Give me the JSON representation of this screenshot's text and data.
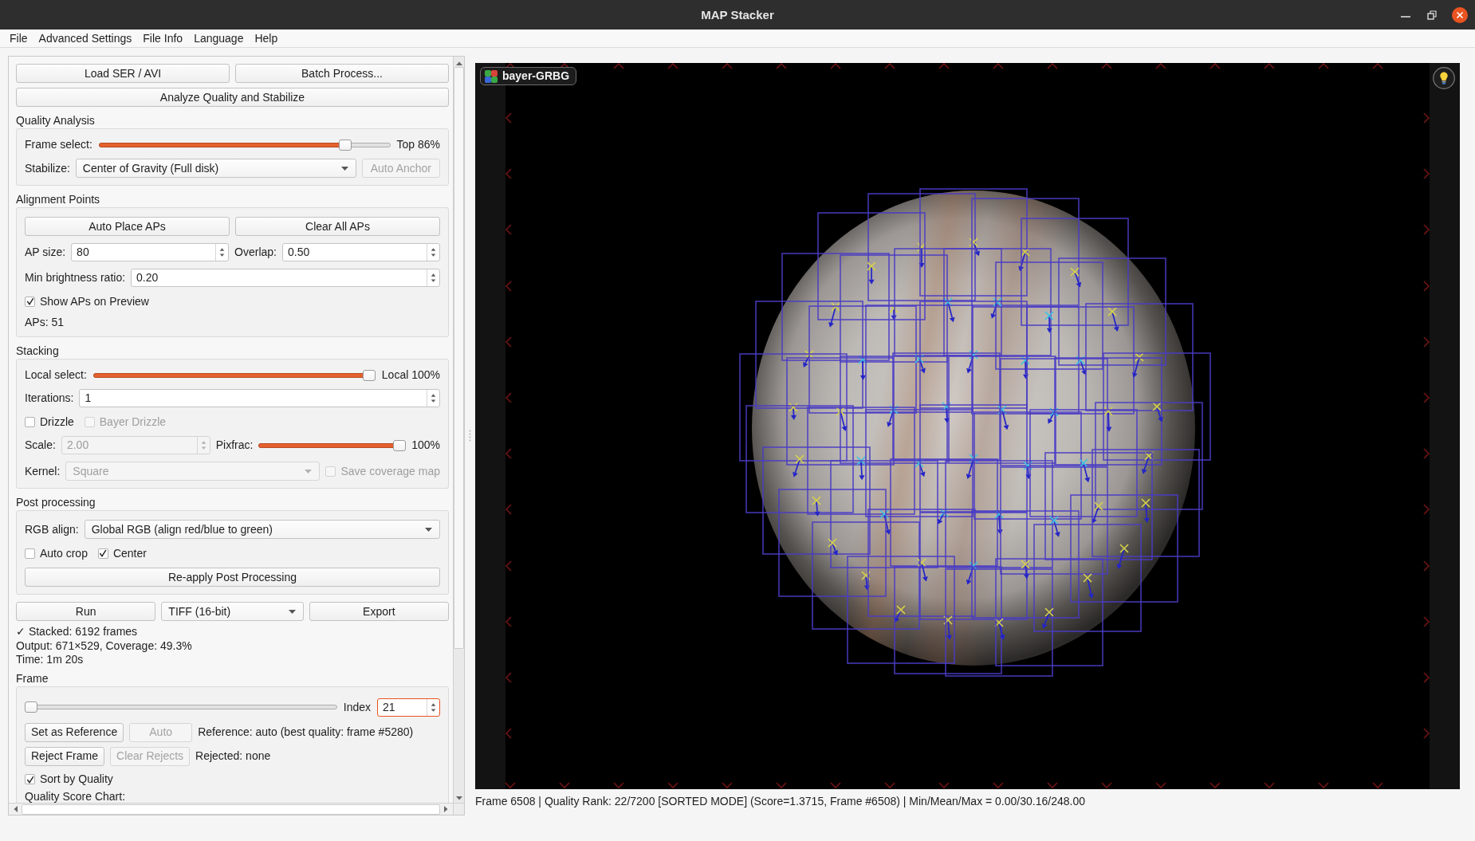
{
  "window": {
    "title": "MAP Stacker"
  },
  "menu": [
    {
      "label": "File"
    },
    {
      "label": "Advanced Settings"
    },
    {
      "label": "File Info"
    },
    {
      "label": "Language"
    },
    {
      "label": "Help"
    }
  ],
  "top_buttons": [
    {
      "label": "Load SER / AVI",
      "disabled": false
    },
    {
      "label": "Batch Process...",
      "disabled": false
    },
    {
      "label": "Analyze Quality and Stabilize",
      "disabled": false
    }
  ],
  "quality_analysis": {
    "title": "Quality Analysis",
    "frame_select": {
      "label": "Frame select:",
      "level": 0.86,
      "reading": "Top 86%"
    },
    "stabilize": {
      "label": "Stabilize:",
      "value": "Center of Gravity (Full disk)",
      "disabled": false
    },
    "auto_anchor": {
      "label": "Auto Anchor",
      "disabled": true
    }
  },
  "alignment_points": {
    "title": "Alignment Points",
    "buttons": [
      {
        "label": "Auto Place APs",
        "disabled": false
      },
      {
        "label": "Clear All APs",
        "disabled": false
      }
    ],
    "ap_size": {
      "label": "AP size:",
      "value": "80",
      "disabled": false
    },
    "overlap": {
      "label": "Overlap:",
      "value": "0.50",
      "disabled": false
    },
    "min_brightness": {
      "label": "Min brightness ratio:",
      "value": "0.20",
      "disabled": false
    },
    "show_aps": {
      "label": "Show APs on Preview",
      "checked": true,
      "disabled": false
    },
    "count": "APs: 51"
  },
  "stacking": {
    "title": "Stacking",
    "local_select": {
      "label": "Local select:",
      "level": 1,
      "reading": "Local 100%"
    },
    "iterations": {
      "label": "Iterations:",
      "value": "1",
      "disabled": false
    },
    "drizzle": {
      "label": "Drizzle",
      "checked": false,
      "disabled": false
    },
    "bayer_drizzle": {
      "label": "Bayer Drizzle",
      "checked": false,
      "disabled": true
    },
    "scale": {
      "label": "Scale:",
      "value": "2.00",
      "disabled": true
    },
    "pixfrac": {
      "label": "Pixfrac:",
      "level": 1,
      "reading": "100%"
    },
    "kernel": {
      "label": "Kernel:",
      "value": "Square",
      "disabled": true
    },
    "save_coverage_map": {
      "label": "Save coverage map",
      "checked": false,
      "disabled": true
    }
  },
  "post_processing": {
    "title": "Post processing",
    "rgb_align": {
      "label": "RGB align:",
      "value": "Global RGB (align red/blue to green)",
      "disabled": false
    },
    "auto_crop": {
      "label": "Auto crop",
      "checked": false,
      "disabled": false
    },
    "center": {
      "label": "Center",
      "checked": true,
      "disabled": false
    },
    "reapply": {
      "label": "Re-apply Post Processing",
      "disabled": false
    }
  },
  "run_bar": {
    "run": {
      "label": "Run",
      "disabled": false
    },
    "format": {
      "value": "TIFF (16-bit)",
      "disabled": false
    },
    "export": {
      "label": "Export",
      "disabled": false
    }
  },
  "result_lines": [
    "✓ Stacked: 6192 frames",
    "Output: 671×529, Coverage: 49.3%",
    "Time: 1m 20s"
  ],
  "frame": {
    "title": "Frame",
    "slider": {
      "level": 0
    },
    "index": {
      "label": "Index",
      "value": "21",
      "disabled": false,
      "focused": true
    },
    "set_reference": {
      "label": "Set as Reference",
      "disabled": false
    },
    "auto": {
      "label": "Auto",
      "disabled": true
    },
    "reference_info": "Reference: auto (best quality: frame #5280)",
    "reject": {
      "label": "Reject Frame",
      "disabled": false
    },
    "clear_rejects": {
      "label": "Clear Rejects",
      "disabled": true
    },
    "rejected_info": "Rejected: none",
    "sort_by_quality": {
      "label": "Sort by Quality",
      "checked": true,
      "disabled": false
    },
    "chart_label": "Quality Score Chart:"
  },
  "preview": {
    "badge": "bayer-GRBG"
  },
  "status_bar": {
    "text": "Frame 6508 | Quality Rank: 22/7200 [SORTED MODE] (Score=1.3715, Frame #6508) | Min/Mean/Max = 0.00/30.16/248.00"
  }
}
